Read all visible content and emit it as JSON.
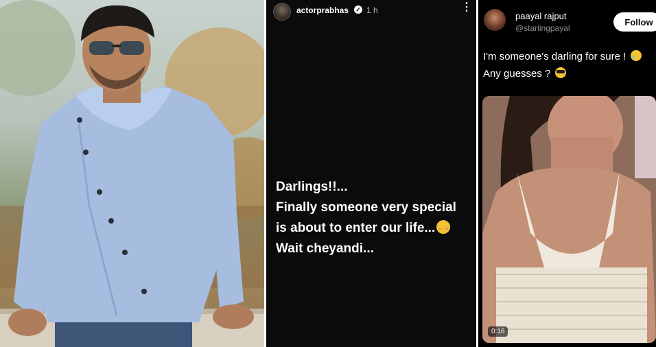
{
  "story": {
    "handle": "actorprabhas",
    "time": "1 h",
    "lines": [
      "Darlings!!...",
      "Finally someone very special",
      "is about to enter our life...",
      "Wait cheyandi..."
    ]
  },
  "tweet": {
    "name": "paayal rajput",
    "handle": "@starlingpayal",
    "follow_label": "Follow",
    "lines": [
      "I'm someone's darling for sure !",
      "Any guesses ?"
    ],
    "video_duration": "0:16"
  }
}
